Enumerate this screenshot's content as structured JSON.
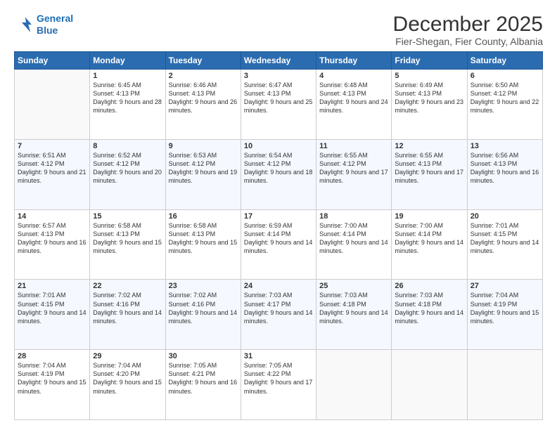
{
  "logo": {
    "line1": "General",
    "line2": "Blue"
  },
  "header": {
    "month": "December 2025",
    "location": "Fier-Shegan, Fier County, Albania"
  },
  "weekdays": [
    "Sunday",
    "Monday",
    "Tuesday",
    "Wednesday",
    "Thursday",
    "Friday",
    "Saturday"
  ],
  "weeks": [
    [
      {
        "day": "",
        "sunrise": "",
        "sunset": "",
        "daylight": ""
      },
      {
        "day": "1",
        "sunrise": "Sunrise: 6:45 AM",
        "sunset": "Sunset: 4:13 PM",
        "daylight": "Daylight: 9 hours and 28 minutes."
      },
      {
        "day": "2",
        "sunrise": "Sunrise: 6:46 AM",
        "sunset": "Sunset: 4:13 PM",
        "daylight": "Daylight: 9 hours and 26 minutes."
      },
      {
        "day": "3",
        "sunrise": "Sunrise: 6:47 AM",
        "sunset": "Sunset: 4:13 PM",
        "daylight": "Daylight: 9 hours and 25 minutes."
      },
      {
        "day": "4",
        "sunrise": "Sunrise: 6:48 AM",
        "sunset": "Sunset: 4:13 PM",
        "daylight": "Daylight: 9 hours and 24 minutes."
      },
      {
        "day": "5",
        "sunrise": "Sunrise: 6:49 AM",
        "sunset": "Sunset: 4:13 PM",
        "daylight": "Daylight: 9 hours and 23 minutes."
      },
      {
        "day": "6",
        "sunrise": "Sunrise: 6:50 AM",
        "sunset": "Sunset: 4:12 PM",
        "daylight": "Daylight: 9 hours and 22 minutes."
      }
    ],
    [
      {
        "day": "7",
        "sunrise": "Sunrise: 6:51 AM",
        "sunset": "Sunset: 4:12 PM",
        "daylight": "Daylight: 9 hours and 21 minutes."
      },
      {
        "day": "8",
        "sunrise": "Sunrise: 6:52 AM",
        "sunset": "Sunset: 4:12 PM",
        "daylight": "Daylight: 9 hours and 20 minutes."
      },
      {
        "day": "9",
        "sunrise": "Sunrise: 6:53 AM",
        "sunset": "Sunset: 4:12 PM",
        "daylight": "Daylight: 9 hours and 19 minutes."
      },
      {
        "day": "10",
        "sunrise": "Sunrise: 6:54 AM",
        "sunset": "Sunset: 4:12 PM",
        "daylight": "Daylight: 9 hours and 18 minutes."
      },
      {
        "day": "11",
        "sunrise": "Sunrise: 6:55 AM",
        "sunset": "Sunset: 4:12 PM",
        "daylight": "Daylight: 9 hours and 17 minutes."
      },
      {
        "day": "12",
        "sunrise": "Sunrise: 6:55 AM",
        "sunset": "Sunset: 4:13 PM",
        "daylight": "Daylight: 9 hours and 17 minutes."
      },
      {
        "day": "13",
        "sunrise": "Sunrise: 6:56 AM",
        "sunset": "Sunset: 4:13 PM",
        "daylight": "Daylight: 9 hours and 16 minutes."
      }
    ],
    [
      {
        "day": "14",
        "sunrise": "Sunrise: 6:57 AM",
        "sunset": "Sunset: 4:13 PM",
        "daylight": "Daylight: 9 hours and 16 minutes."
      },
      {
        "day": "15",
        "sunrise": "Sunrise: 6:58 AM",
        "sunset": "Sunset: 4:13 PM",
        "daylight": "Daylight: 9 hours and 15 minutes."
      },
      {
        "day": "16",
        "sunrise": "Sunrise: 6:58 AM",
        "sunset": "Sunset: 4:13 PM",
        "daylight": "Daylight: 9 hours and 15 minutes."
      },
      {
        "day": "17",
        "sunrise": "Sunrise: 6:59 AM",
        "sunset": "Sunset: 4:14 PM",
        "daylight": "Daylight: 9 hours and 14 minutes."
      },
      {
        "day": "18",
        "sunrise": "Sunrise: 7:00 AM",
        "sunset": "Sunset: 4:14 PM",
        "daylight": "Daylight: 9 hours and 14 minutes."
      },
      {
        "day": "19",
        "sunrise": "Sunrise: 7:00 AM",
        "sunset": "Sunset: 4:14 PM",
        "daylight": "Daylight: 9 hours and 14 minutes."
      },
      {
        "day": "20",
        "sunrise": "Sunrise: 7:01 AM",
        "sunset": "Sunset: 4:15 PM",
        "daylight": "Daylight: 9 hours and 14 minutes."
      }
    ],
    [
      {
        "day": "21",
        "sunrise": "Sunrise: 7:01 AM",
        "sunset": "Sunset: 4:15 PM",
        "daylight": "Daylight: 9 hours and 14 minutes."
      },
      {
        "day": "22",
        "sunrise": "Sunrise: 7:02 AM",
        "sunset": "Sunset: 4:16 PM",
        "daylight": "Daylight: 9 hours and 14 minutes."
      },
      {
        "day": "23",
        "sunrise": "Sunrise: 7:02 AM",
        "sunset": "Sunset: 4:16 PM",
        "daylight": "Daylight: 9 hours and 14 minutes."
      },
      {
        "day": "24",
        "sunrise": "Sunrise: 7:03 AM",
        "sunset": "Sunset: 4:17 PM",
        "daylight": "Daylight: 9 hours and 14 minutes."
      },
      {
        "day": "25",
        "sunrise": "Sunrise: 7:03 AM",
        "sunset": "Sunset: 4:18 PM",
        "daylight": "Daylight: 9 hours and 14 minutes."
      },
      {
        "day": "26",
        "sunrise": "Sunrise: 7:03 AM",
        "sunset": "Sunset: 4:18 PM",
        "daylight": "Daylight: 9 hours and 14 minutes."
      },
      {
        "day": "27",
        "sunrise": "Sunrise: 7:04 AM",
        "sunset": "Sunset: 4:19 PM",
        "daylight": "Daylight: 9 hours and 15 minutes."
      }
    ],
    [
      {
        "day": "28",
        "sunrise": "Sunrise: 7:04 AM",
        "sunset": "Sunset: 4:19 PM",
        "daylight": "Daylight: 9 hours and 15 minutes."
      },
      {
        "day": "29",
        "sunrise": "Sunrise: 7:04 AM",
        "sunset": "Sunset: 4:20 PM",
        "daylight": "Daylight: 9 hours and 15 minutes."
      },
      {
        "day": "30",
        "sunrise": "Sunrise: 7:05 AM",
        "sunset": "Sunset: 4:21 PM",
        "daylight": "Daylight: 9 hours and 16 minutes."
      },
      {
        "day": "31",
        "sunrise": "Sunrise: 7:05 AM",
        "sunset": "Sunset: 4:22 PM",
        "daylight": "Daylight: 9 hours and 17 minutes."
      },
      {
        "day": "",
        "sunrise": "",
        "sunset": "",
        "daylight": ""
      },
      {
        "day": "",
        "sunrise": "",
        "sunset": "",
        "daylight": ""
      },
      {
        "day": "",
        "sunrise": "",
        "sunset": "",
        "daylight": ""
      }
    ]
  ]
}
